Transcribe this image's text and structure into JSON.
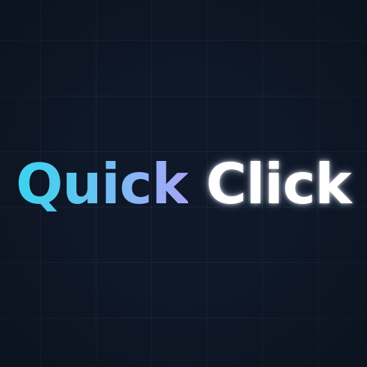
{
  "logo": {
    "word1": "Quick",
    "word2": "Click"
  },
  "colors": {
    "background": "#0f1828",
    "grid": "#1d2d44",
    "quick_gradient_start": "#3ad3ee",
    "quick_gradient_end": "#a6a6f8",
    "click": "#ffffff"
  }
}
